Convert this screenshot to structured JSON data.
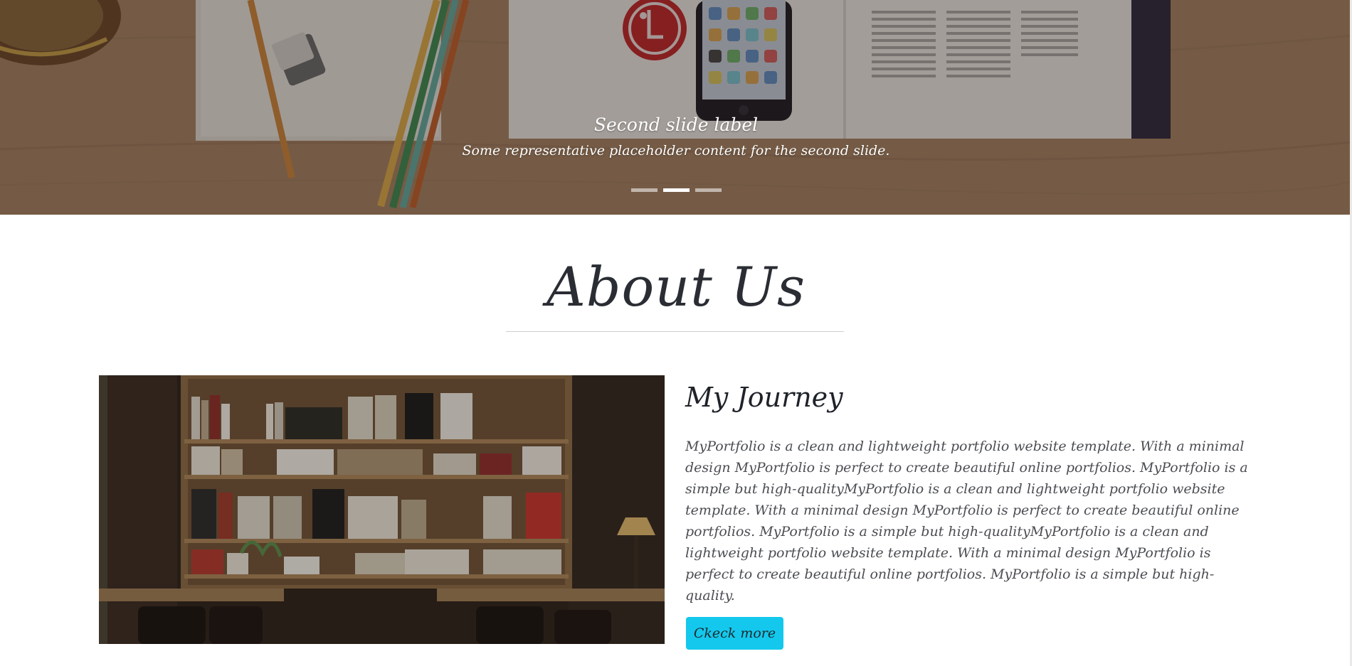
{
  "carousel": {
    "active_slide": 2,
    "slide_count": 3,
    "caption_title": "Second slide label",
    "caption_text": "Some representative placeholder content for the second slide.",
    "indicators": [
      {
        "label": "Slide 1",
        "active": false
      },
      {
        "label": "Slide 2",
        "active": true
      },
      {
        "label": "Slide 3",
        "active": false
      }
    ],
    "photo_logo_text": "LG"
  },
  "about": {
    "title": "About Us",
    "journey_title": "My Journey",
    "journey_text": "MyPortfolio is a clean and lightweight portfolio website template. With a minimal design MyPortfolio is perfect to create beautiful online portfolios. MyPortfolio is a simple but high-qualityMyPortfolio is a clean and lightweight portfolio website template. With a minimal design MyPortfolio is perfect to create beautiful online portfolios. MyPortfolio is a simple but high-qualityMyPortfolio is a clean and lightweight portfolio website template. With a minimal design MyPortfolio is perfect to create beautiful online portfolios. MyPortfolio is a simple but high-quality.",
    "button_label": "Ckeck more"
  },
  "colors": {
    "button": "#13c8ec",
    "heading": "#2a2d33",
    "body_text": "#4a4d52",
    "rule": "#cfcfcf"
  }
}
